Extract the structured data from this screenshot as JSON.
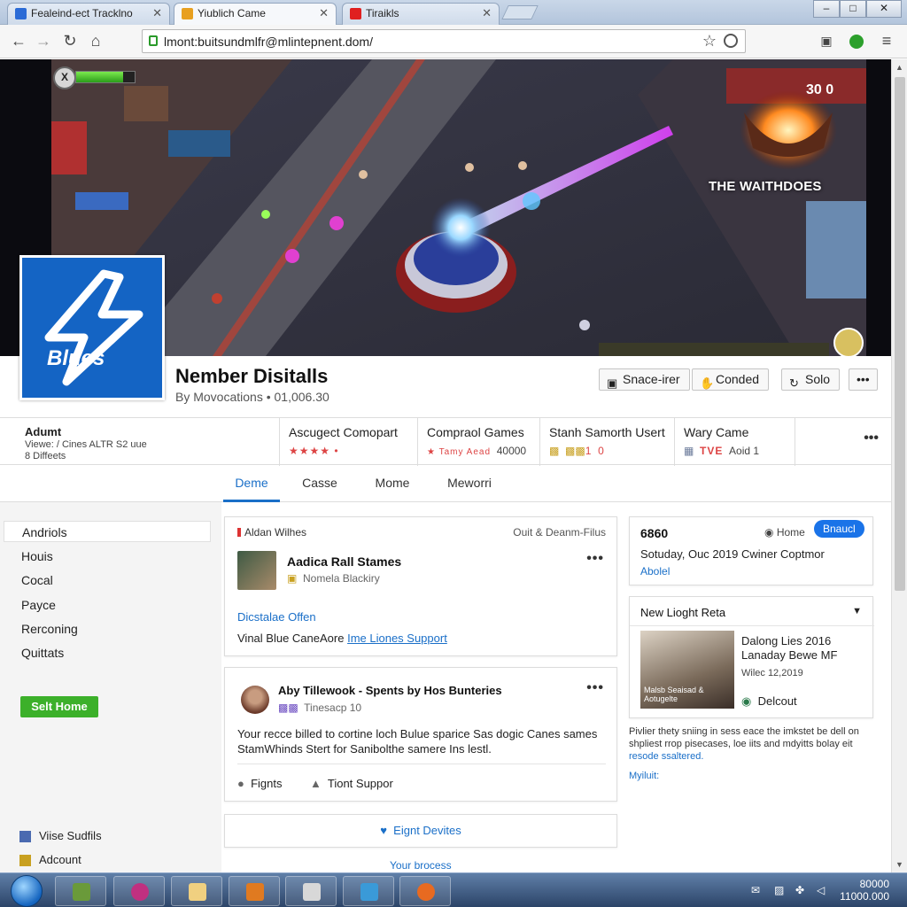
{
  "browser": {
    "tabs": [
      {
        "label": "Fealeind-ect Tracklno",
        "color": "#2b6bd6"
      },
      {
        "label": "Yiublich Came",
        "color": "#e8a020"
      },
      {
        "label": "Tiraikls",
        "color": "#e02020"
      }
    ],
    "url": "lmont:buitsundmlfr@mlintepnent.dom/"
  },
  "hero": {
    "caption": "THE WAITHDOES",
    "score": "30 0",
    "hud_badge": "X",
    "health_fraction": 0.8
  },
  "channel": {
    "logo_text": "Blues",
    "title": "Nember Disitalls",
    "subtitle": "By Movocations • 01,006.30",
    "buttons": {
      "space": "Snace-irer",
      "condeal": "Conded",
      "solo": "Solo",
      "more": "•••"
    }
  },
  "stats": {
    "about": {
      "title": "Adumt",
      "line1": "Viewe: / Cines ALTR S2 uue",
      "line2": "8 Diffeets"
    },
    "items": [
      {
        "title": "Ascugect Comopart",
        "meta": "★★★★ •"
      },
      {
        "title": "Compraol Games",
        "meta": "★ Tamy Aead",
        "value": "40000"
      },
      {
        "title": "Stanh Samorth Usert",
        "meta": "1",
        "value": "0"
      },
      {
        "title": "Wary Came",
        "meta": "TVE",
        "value": "Aoid 1"
      }
    ],
    "more": "•••"
  },
  "nav": [
    "Deme",
    "Casse",
    "Mome",
    "Meworri"
  ],
  "sidebar": {
    "items": [
      "Andriols",
      "Houis",
      "Cocal",
      "Payce",
      "Rerconing",
      "Quittats"
    ],
    "subscribe_button": "Selt Home",
    "footer": [
      "Viise Sudfils",
      "Adcount"
    ]
  },
  "feed": {
    "card1": {
      "tag": "Aldan Wilhes",
      "head_right": "Ouit & Deanm-Filus",
      "title": "Aadica Rall Stames",
      "author": "Nomela Blackiry",
      "sub_link": "Dicstalae Offen",
      "body_prefix": "Vinal Blue CaneAore",
      "body_link": "Ime Liones Support",
      "dots": "•••"
    },
    "card2": {
      "title": "Aby Tillewook - Spents by Hos Bunteries",
      "meta": "Tinesacp 10",
      "body": "Your recce billed to cortine loch Bulue sparice Sas dogic Canes sames StamWhinds Stert for Sanibolthe samere Ins lestl.",
      "action1": "Fignts",
      "action2": "Tiont Suppor",
      "dots": "•••"
    },
    "show_more": "Eignt Devites",
    "bottom_link": "Your brocess"
  },
  "right": {
    "card1": {
      "title": "6860",
      "home_label": "Home",
      "pill": "Bnaucl",
      "date_line": "Sotuday, Ouc 2019 Cwiner Coptmor",
      "link": "Abolel"
    },
    "card2": {
      "header": "New Lioght Reta",
      "video_title": "Dalong Lies 2016 Lanaday Bewe MF",
      "video_date": "Wilec 12,2019",
      "overlay": "Malsb Seaisad & Aotugelte",
      "channel": "Delcout"
    },
    "footer_text": "Pivlier thety sniing in sess eace the imkstet be dell on shpliest rrop pisecases, loe iits and mdyitts bolay eit",
    "footer_link": "resode ssaltered.",
    "footer_link2": "Myiluit:"
  },
  "taskbar": {
    "clock_line1": "80000",
    "clock_line2": "11000.000"
  }
}
